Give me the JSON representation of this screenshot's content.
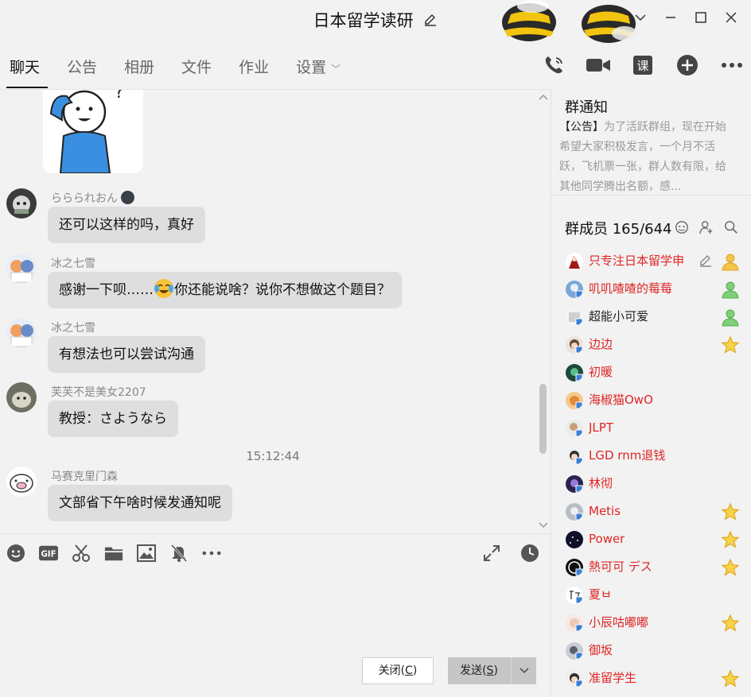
{
  "window": {
    "title": "日本留学读研"
  },
  "tabs": [
    {
      "label": "聊天"
    },
    {
      "label": "公告"
    },
    {
      "label": "相册"
    },
    {
      "label": "文件"
    },
    {
      "label": "作业"
    },
    {
      "label": "设置"
    }
  ],
  "toolbar_icons": [
    "phone-icon",
    "video-icon",
    "lesson-icon",
    "add-icon",
    "more-icon"
  ],
  "messages": [
    {
      "sender": "ららられおん",
      "text": "还可以这样的吗，真好"
    },
    {
      "sender": "冰之七雪",
      "text_before": "感谢一下呗……",
      "text_after": "你还能说啥？说你不想做这个题目？"
    },
    {
      "sender": "冰之七雪",
      "text": "有想法也可以尝试沟通"
    },
    {
      "sender": "芙芙不是美女2207",
      "text": "教授：さようなら"
    },
    {
      "sender": "马赛克里门森",
      "text": "文部省下午啥时候发通知呢"
    }
  ],
  "timestamp": "15:12:44",
  "input_toolbar": [
    "emoji-icon",
    "gif-icon",
    "scissors-icon",
    "folder-icon",
    "image-icon",
    "mute-bell-icon",
    "more-icon",
    "fullscreen-icon",
    "history-clock-icon"
  ],
  "buttons": {
    "close_prefix": "关闭(",
    "close_key": "C",
    "close_suffix": ")",
    "send_prefix": "发送(",
    "send_key": "S",
    "send_suffix": ")"
  },
  "notice": {
    "title": "群通知",
    "tag": "【公告】",
    "body": "为了活跃群组，现在开始希望大家积极发言，一个月不活跃，飞机票一张，群人数有限，给其他同学腾出名额，感..."
  },
  "members_header": {
    "label": "群成员 165/644"
  },
  "members": [
    {
      "name": "只专注日本留学申",
      "color": "red",
      "badge": "owner"
    },
    {
      "name": "叽叽喳喳的莓莓",
      "color": "red",
      "badge": "admin"
    },
    {
      "name": "超能小可爱",
      "color": "black",
      "badge": "admin"
    },
    {
      "name": "边边",
      "color": "red",
      "badge": "star"
    },
    {
      "name": "初暖",
      "color": "red",
      "badge": ""
    },
    {
      "name": "海椒猫OwO",
      "color": "red",
      "badge": ""
    },
    {
      "name": "JLPT",
      "color": "red",
      "badge": ""
    },
    {
      "name": "LGD rnm退钱",
      "color": "red",
      "badge": ""
    },
    {
      "name": "林彻",
      "color": "red",
      "badge": ""
    },
    {
      "name": "Metis",
      "color": "red",
      "badge": "star"
    },
    {
      "name": "Power",
      "color": "red",
      "badge": "star"
    },
    {
      "name": "熱可可 デス",
      "color": "red",
      "badge": "star"
    },
    {
      "name": "夏ㅂ",
      "color": "red",
      "badge": ""
    },
    {
      "name": "小辰咕嘟嘟",
      "color": "red",
      "badge": "star"
    },
    {
      "name": "御坂",
      "color": "red",
      "badge": ""
    },
    {
      "name": "准留学生",
      "color": "red",
      "badge": "star"
    }
  ]
}
